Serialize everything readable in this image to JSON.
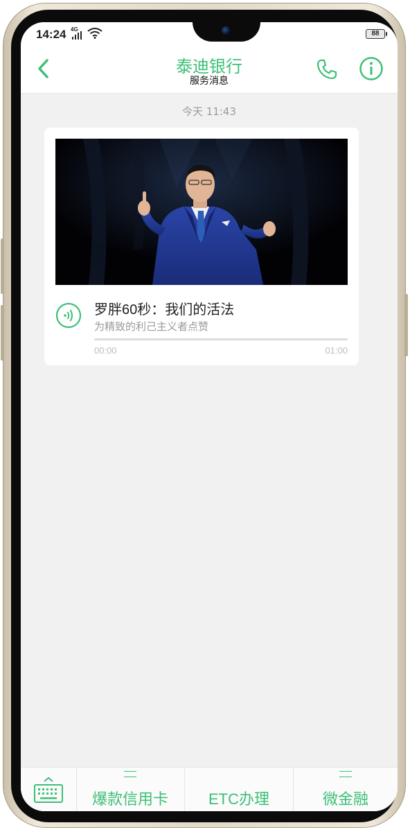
{
  "status_bar": {
    "time": "14:24",
    "network": "4G",
    "battery": "88"
  },
  "header": {
    "title": "泰迪银行",
    "subtitle": "服务消息",
    "back_icon": "chevron-left-icon",
    "call_icon": "phone-icon",
    "info_icon": "info-icon"
  },
  "chat": {
    "timestamp": "今天 11:43",
    "card": {
      "image_icon": "speaker-photo",
      "title": "罗胖60秒：我们的活法",
      "subtitle": "为精致的利己主义者点赞",
      "time_start": "00:00",
      "time_end": "01:00",
      "progress": 0
    }
  },
  "bottom_menu": {
    "keyboard_icon": "keyboard-icon",
    "items": [
      {
        "label": "爆款信用卡",
        "has_submenu": true
      },
      {
        "label": "ETC办理",
        "has_submenu": false
      },
      {
        "label": "微金融",
        "has_submenu": true
      }
    ]
  },
  "colors": {
    "accent": "#3cbf77",
    "background": "#f1f1f1"
  }
}
